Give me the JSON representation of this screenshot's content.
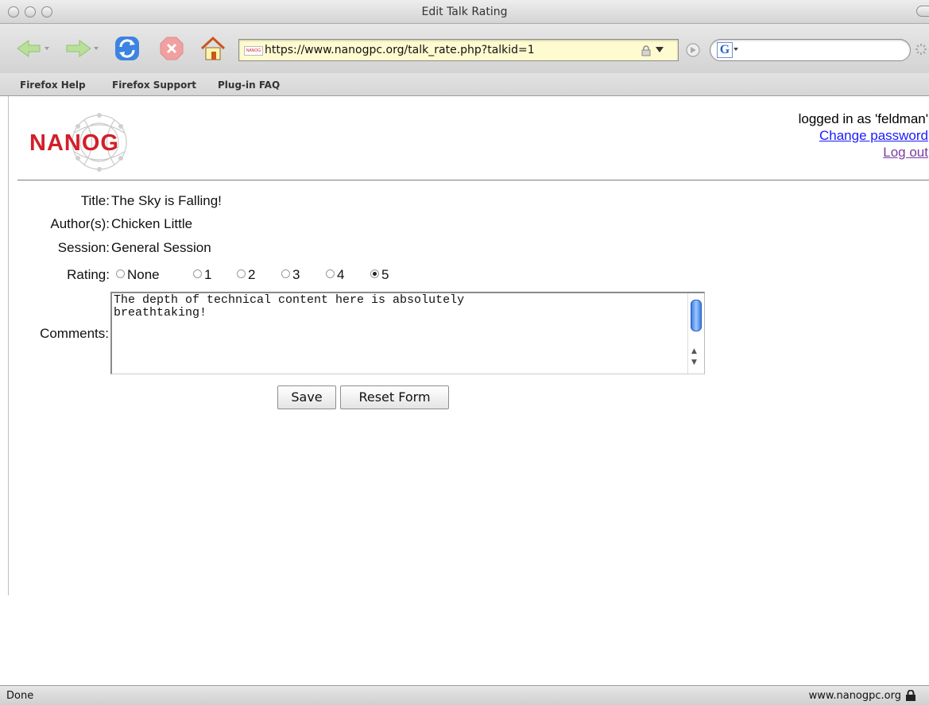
{
  "window": {
    "title": "Edit Talk Rating"
  },
  "toolbar": {
    "url": "https://www.nanogpc.org/talk_rate.php?talkid=1",
    "favicon_text": "NANOG",
    "search_engine_letter": "G"
  },
  "bookmarks": [
    "Firefox Help",
    "Firefox Support",
    "Plug-in FAQ"
  ],
  "header": {
    "logo_text": "NANOG",
    "logged_in_text": "logged in as 'feldman'",
    "change_password": "Change password",
    "log_out": "Log out"
  },
  "form": {
    "title_label": "Title:",
    "title_value": "The Sky is Falling!",
    "authors_label": "Author(s):",
    "authors_value": "Chicken Little",
    "session_label": "Session:",
    "session_value": "General Session",
    "rating_label": "Rating:",
    "rating_options": [
      "None",
      "1",
      "2",
      "3",
      "4",
      "5"
    ],
    "rating_selected": "5",
    "comments_label": "Comments:",
    "comments_value": "The depth of technical content here is absolutely\nbreathtaking!",
    "save_label": "Save",
    "reset_label": "Reset Form"
  },
  "status": {
    "left": "Done",
    "right": "www.nanogpc.org"
  }
}
